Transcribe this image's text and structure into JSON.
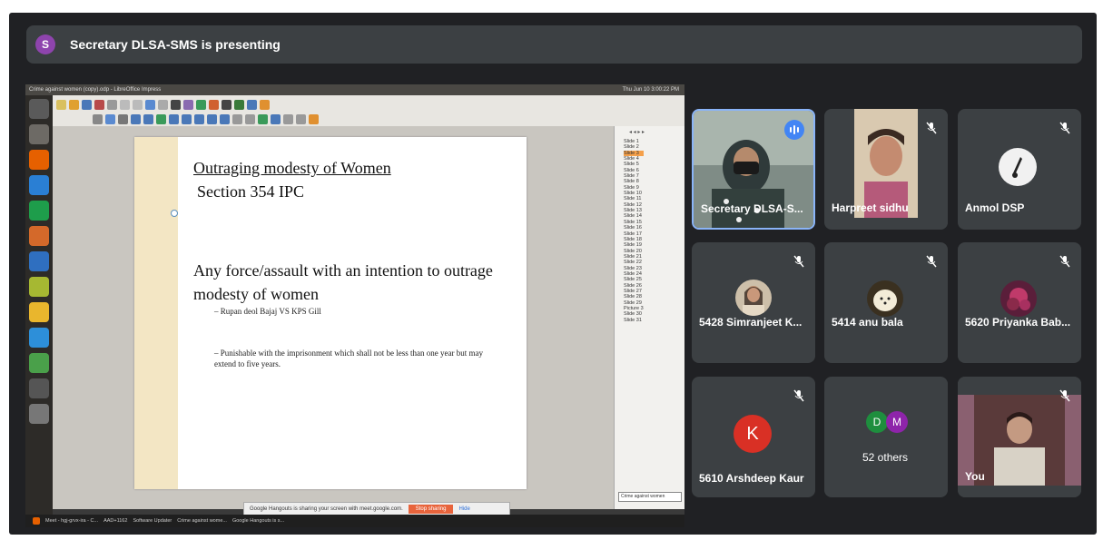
{
  "presenter_bar": {
    "avatar_letter": "S",
    "text": "Secretary DLSA-SMS is presenting"
  },
  "shared_screen": {
    "window_title": "Crime against women (copy).odp - LibreOffice Impress",
    "clock": "Thu Jun 10 3:00:22 PM",
    "slide": {
      "title": "Outraging modesty of Women",
      "subtitle": "Section 354 IPC",
      "body": "Any force/assault with an intention to outrage modesty of  women",
      "bullet1": "–  Rupan deol Bajaj VS KPS Gill",
      "bullet2": "–  Punishable with the imprisonment which shall not be less than one year but may extend to five years."
    },
    "slide_pane": {
      "slides": [
        "Slide 1",
        "Slide 2",
        "Slide 3",
        "Slide 4",
        "Slide 5",
        "Slide 6",
        "Slide 7",
        "Slide 8",
        "Slide 9",
        "Slide 10",
        "Slide 11",
        "Slide 12",
        "Slide 13",
        "Slide 14",
        "Slide 15",
        "Slide 16",
        "Slide 17",
        "Slide 18",
        "Slide 19",
        "Slide 20",
        "Slide 21",
        "Slide 22",
        "Slide 23",
        "Slide 24",
        "Slide 25",
        "Slide 26",
        "Slide 27",
        "Slide 28",
        "Slide 29",
        "Picture 3",
        "Slide 30",
        "Slide 31"
      ],
      "active_index": 2,
      "footer_label": "Crime against women"
    },
    "share_notice": {
      "text": "Google Hangouts is sharing your screen with meet.google.com.",
      "stop_label": "Stop sharing",
      "hide_label": "Hide"
    },
    "taskbar": {
      "item1": "Meet - hgj-grvx-ira - C...",
      "item2": "AAD+1162",
      "item3": "Software Updater",
      "item4": "Crime against wome...",
      "item5": "Google Hangouts is s..."
    }
  },
  "participants": [
    {
      "name": "Secretary DLSA-S...",
      "type": "video",
      "speaking": true
    },
    {
      "name": "Harpreet sidhu",
      "type": "video",
      "muted": true
    },
    {
      "name": "Anmol DSP",
      "type": "avatar",
      "muted": true
    },
    {
      "name": "5428 Simranjeet K...",
      "type": "photo",
      "muted": true
    },
    {
      "name": "5414 anu bala",
      "type": "photo",
      "muted": true
    },
    {
      "name": "5620 Priyanka Bab...",
      "type": "photo",
      "muted": true
    },
    {
      "name": "5610 Arshdeep Kaur",
      "type": "letter",
      "letter": "K",
      "muted": true
    },
    {
      "name": "52 others",
      "type": "group",
      "letters": [
        "D",
        "M"
      ]
    },
    {
      "name": "You",
      "type": "video",
      "muted": true
    }
  ],
  "colors": {
    "meet_bg": "#202124",
    "tile_bg": "#3c4043",
    "speaking_blue": "#4285f4",
    "letter_avatar_red": "#d93025",
    "group_green": "#1e8e3e",
    "group_purple": "#8e24aa"
  }
}
